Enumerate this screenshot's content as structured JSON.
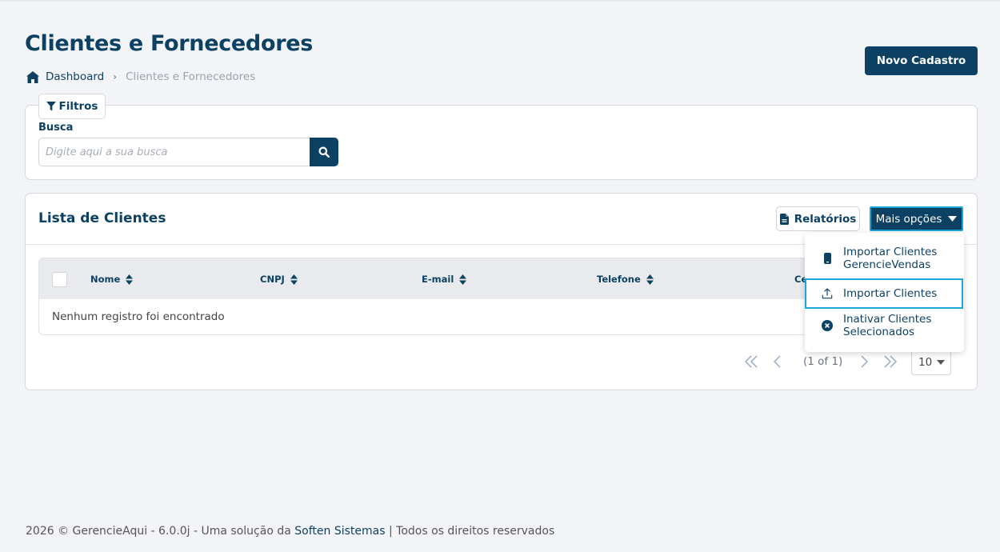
{
  "page": {
    "title": "Clientes e Fornecedores",
    "new_button": "Novo Cadastro"
  },
  "breadcrumb": {
    "home": "Dashboard",
    "separator": "›",
    "current": "Clientes e Fornecedores"
  },
  "filters": {
    "tab_label": "Filtros",
    "search_label": "Busca",
    "search_placeholder": "Digite aqui a sua busca",
    "search_value": ""
  },
  "list": {
    "title": "Lista de Clientes",
    "reports_button": "Relatórios",
    "more_button": "Mais opções",
    "columns": [
      "Nome",
      "CNPJ",
      "E-mail",
      "Telefone",
      "Ce"
    ],
    "empty_message": "Nenhum registro foi encontrado"
  },
  "pagination": {
    "info": "(1 of 1)",
    "page_size": "10"
  },
  "dropdown": {
    "items": [
      {
        "line1": "Importar Clientes",
        "line2": "GerencieVendas",
        "icon": "mobile-icon"
      },
      {
        "line1": "Importar Clientes",
        "line2": "",
        "icon": "upload-icon"
      },
      {
        "line1": "Inativar Clientes",
        "line2": "Selecionados",
        "icon": "close-circle-icon"
      }
    ]
  },
  "footer": {
    "prefix": "2026 © GerencieAqui - 6.0.0j - Uma solução da ",
    "brand": "Soften Sistemas",
    "suffix": " | Todos os direitos reservados"
  },
  "colors": {
    "primary": "#0c4163",
    "focus": "#18a7d8",
    "background": "#f3f4f7"
  }
}
